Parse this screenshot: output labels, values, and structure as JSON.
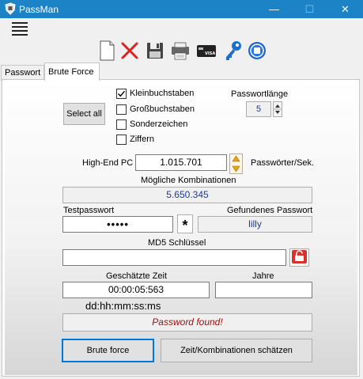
{
  "window": {
    "title": "PassMan",
    "minimize_glyph": "—",
    "maximize_glyph": "☐",
    "close_glyph": "✕"
  },
  "menu": {
    "icon": "hamburger-menu-icon"
  },
  "toolbar": {
    "icons": [
      "new-document-icon",
      "delete-icon",
      "save-icon",
      "printer-icon",
      "credit-card-icon",
      "key-icon",
      "power-icon"
    ],
    "card_text": "VISA"
  },
  "tabs": [
    {
      "label": "Passwort",
      "active": false
    },
    {
      "label": "Brute Force",
      "active": true
    }
  ],
  "brute_force": {
    "select_all_label": "Select all",
    "options": [
      {
        "label": "Kleinbuchstaben",
        "checked": true
      },
      {
        "label": "Großbuchstaben",
        "checked": false
      },
      {
        "label": "Sonderzeichen",
        "checked": false
      },
      {
        "label": "Ziffern",
        "checked": false
      }
    ],
    "password_length_label": "Passwortlänge",
    "password_length_value": "5",
    "high_end_pc_label": "High-End PC",
    "speed_value": "1.015.701",
    "speed_unit_label": "Passwörter/Sek.",
    "combinations_label": "Mögliche Kombinationen",
    "combinations_value": "5.650.345",
    "test_password_label": "Testpasswort",
    "test_password_value": "•••••",
    "toggle_mask_label": "*",
    "found_password_label": "Gefundenes Passwort",
    "found_password_value": "lilly",
    "md5_label": "MD5 Schlüssel",
    "md5_value": "",
    "estimated_time_label": "Geschätzte Zeit",
    "estimated_time_value": "00:00:05:563",
    "years_label": "Jahre",
    "years_value": "",
    "time_format_label": "dd:hh:mm:ss:ms",
    "status_message": "Password found!",
    "brute_force_button": "Brute force",
    "estimate_button": "Zeit/Kombinationen schätzen"
  },
  "colors": {
    "titlebar": "#1c84c6",
    "combinations_text": "#1f3a93",
    "status_text": "#a01010",
    "focus_border": "#0078d7",
    "md5_button": "#d9322a"
  }
}
